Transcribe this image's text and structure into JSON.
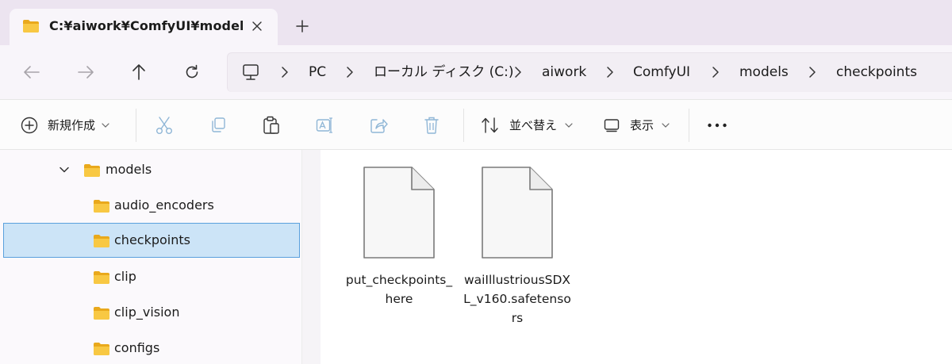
{
  "tab": {
    "title": "C:¥aiwork¥ComfyUI¥models¥c",
    "close_icon": "close-icon",
    "new_tab_icon": "plus-icon"
  },
  "nav": {
    "back_icon": "arrow-left-icon",
    "forward_icon": "arrow-right-icon",
    "up_icon": "arrow-up-icon",
    "refresh_icon": "refresh-icon"
  },
  "breadcrumb": {
    "root_icon": "computer-icon",
    "items": [
      "PC",
      "ローカル ディスク (C:)",
      "aiwork",
      "ComfyUI",
      "models",
      "checkpoints"
    ]
  },
  "toolbar": {
    "new_label": "新規作成",
    "sort_label": "並べ替え",
    "view_label": "表示",
    "more_icon": "more-icon"
  },
  "tree": {
    "parent": "models",
    "items": [
      "audio_encoders",
      "checkpoints",
      "clip",
      "clip_vision",
      "configs"
    ],
    "selected": "checkpoints"
  },
  "files": [
    {
      "name": "put_checkpoints_here",
      "icon": "document-icon"
    },
    {
      "name": "waiIllustriousSDXL_v160.safetensors",
      "icon": "document-icon"
    }
  ],
  "colors": {
    "folder": "#f8c843",
    "selection": "#cce4f7",
    "selection_border": "#5aa0dd"
  }
}
